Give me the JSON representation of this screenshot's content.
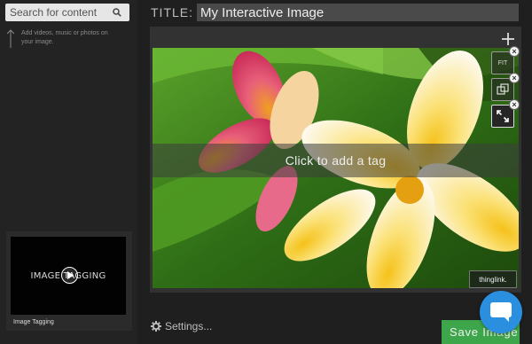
{
  "search": {
    "placeholder": "Search for content"
  },
  "hint": "Add videos, music or photos on your image.",
  "video": {
    "title": "IMAGE TAGGING",
    "caption": "Image Tagging"
  },
  "title_label": "TITLE:",
  "title_value": "My Interactive Image",
  "tag_prompt": "Click to add a tag",
  "tools": {
    "fit_label": "FIT"
  },
  "badge": "thinglink.",
  "settings_label": "Settings...",
  "save_label": "Save Image",
  "icons": [
    "search-icon",
    "arrow-up-icon",
    "play-icon",
    "plus-icon",
    "fit-icon",
    "duplicate-icon",
    "fullscreen-icon",
    "close-icon",
    "gear-icon",
    "chat-icon"
  ],
  "colors": {
    "save": "#3ea64a",
    "chat": "#2b8fe0",
    "background": "#1f1f1f"
  }
}
